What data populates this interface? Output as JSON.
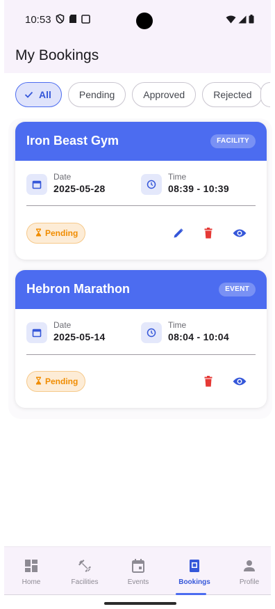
{
  "status_bar": {
    "time": "10:53"
  },
  "app_bar": {
    "title": "My Bookings"
  },
  "filters": [
    {
      "label": "All",
      "selected": true
    },
    {
      "label": "Pending",
      "selected": false
    },
    {
      "label": "Approved",
      "selected": false
    },
    {
      "label": "Rejected",
      "selected": false
    }
  ],
  "bookings": [
    {
      "title": "Iron Beast Gym",
      "type_badge": "FACILITY",
      "date_label": "Date",
      "date": "2025-05-28",
      "time_label": "Time",
      "time": "08:39 - 10:39",
      "status": "Pending",
      "actions": [
        "edit-icon",
        "delete-icon",
        "view-icon"
      ]
    },
    {
      "title": "Hebron Marathon",
      "type_badge": "EVENT",
      "date_label": "Date",
      "date": "2025-05-14",
      "time_label": "Time",
      "time": "08:04 - 10:04",
      "status": "Pending",
      "actions": [
        "delete-icon",
        "view-icon"
      ]
    }
  ],
  "bottom_nav": [
    {
      "label": "Home",
      "icon": "dashboard-icon",
      "active": false
    },
    {
      "label": "Facilities",
      "icon": "fitness-icon",
      "active": false
    },
    {
      "label": "Events",
      "icon": "calendar-event-icon",
      "active": false
    },
    {
      "label": "Bookings",
      "icon": "bookings-icon",
      "active": true
    },
    {
      "label": "Profile",
      "icon": "person-icon",
      "active": false
    }
  ],
  "colors": {
    "primary": "#4c6cf0",
    "danger": "#e53935",
    "pending": "#f08c00",
    "surface": "#f8f2fb"
  }
}
